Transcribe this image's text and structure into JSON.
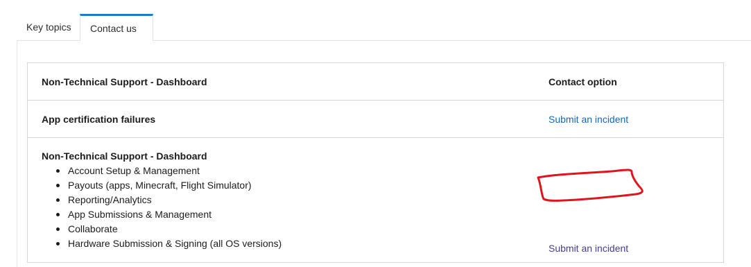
{
  "tabs": [
    {
      "label": "Key topics",
      "active": false
    },
    {
      "label": "Contact us",
      "active": true
    }
  ],
  "table": {
    "headers": {
      "left": "Non-Technical Support - Dashboard",
      "right": "Contact option"
    },
    "rows": [
      {
        "topic": "App certification failures",
        "option": "Submit an incident"
      },
      {
        "topic": "Non-Technical Support - Dashboard",
        "items": [
          "Account Setup & Management",
          "Payouts (apps, Minecraft, Flight Simulator)",
          "Reporting/Analytics",
          "App Submissions & Management",
          "Collaborate",
          "Hardware Submission & Signing (all OS versions)"
        ],
        "option": "Submit an incident"
      }
    ]
  },
  "colors": {
    "accent": "#1f7ac9",
    "link": "#1466b8",
    "visited_link": "#4a3a8c",
    "annotation": "#e0141c"
  }
}
